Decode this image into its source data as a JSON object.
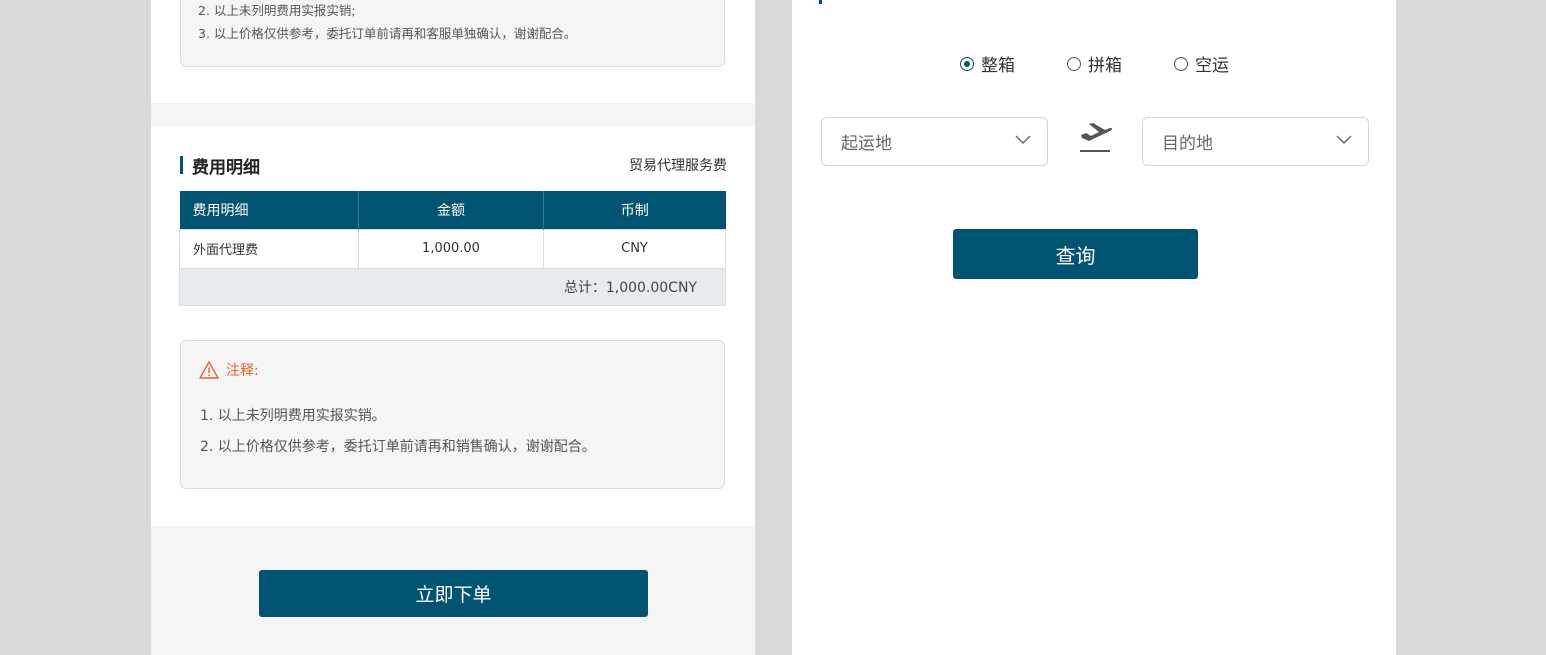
{
  "top_notes": {
    "lines": [
      "2. 以上未列明费用实报实销;",
      "3. 以上价格仅供参考，委托订单前请再和客服单独确认，谢谢配合。"
    ]
  },
  "fees": {
    "section_title": "费用明细",
    "right_label": "贸易代理服务费",
    "headers": [
      "费用明细",
      "金额",
      "币制"
    ],
    "rows": [
      [
        "外面代理费",
        "1,000.00",
        "CNY"
      ]
    ],
    "total": "总计：1,000.00CNY"
  },
  "note": {
    "title": "注释:",
    "lines": [
      "1. 以上未列明费用实报实销。",
      "2. 以上价格仅供参考，委托订单前请再和销售确认，谢谢配合。"
    ]
  },
  "order_button": "立即下单",
  "search": {
    "modes": [
      {
        "label": "整箱",
        "selected": true
      },
      {
        "label": "拼箱",
        "selected": false
      },
      {
        "label": "空运",
        "selected": false
      }
    ],
    "origin_placeholder": "起运地",
    "destination_placeholder": "目的地",
    "query_button": "查询"
  },
  "colors": {
    "primary": "#005371",
    "warning": "#e8622a"
  }
}
